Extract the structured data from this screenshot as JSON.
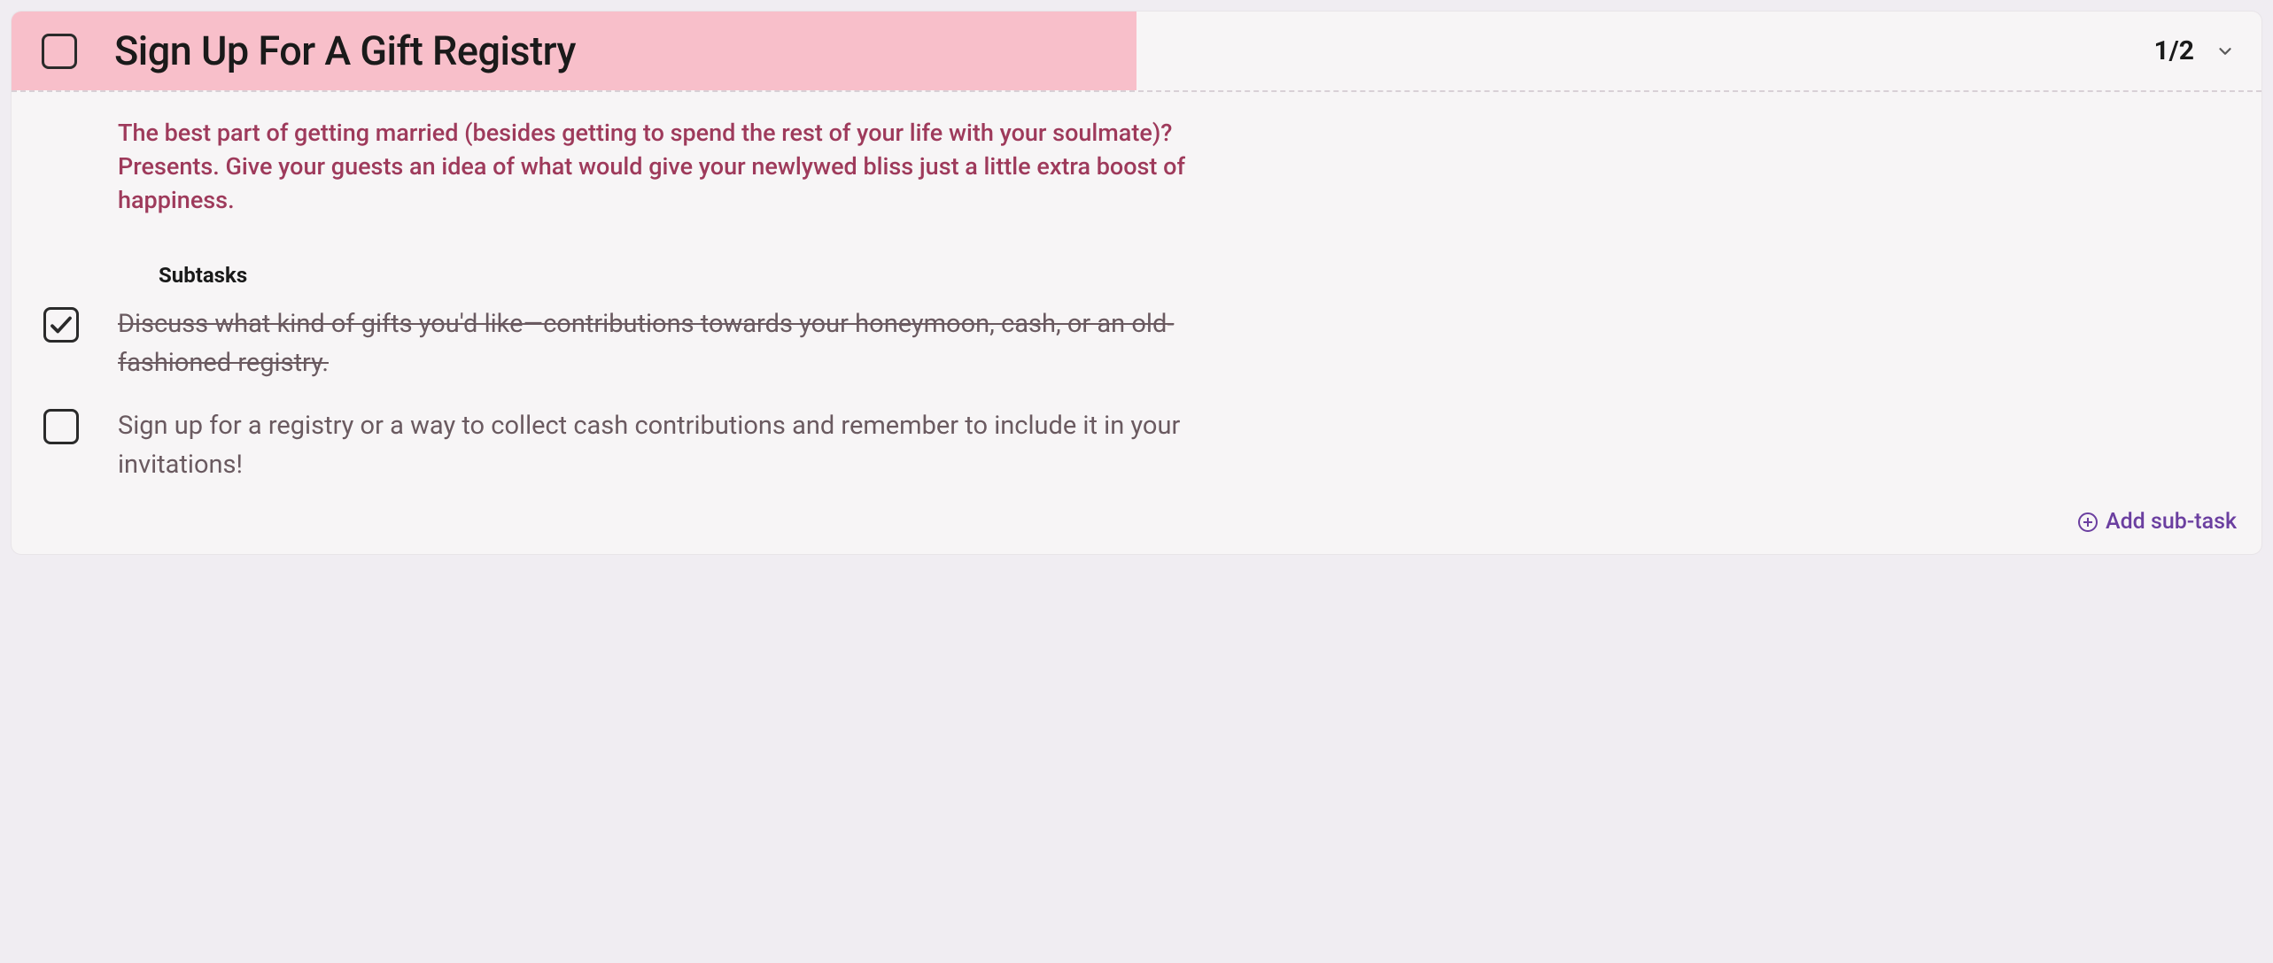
{
  "task": {
    "title": "Sign Up For A Gift Registry",
    "progress": "1/2",
    "completed": false,
    "description": "The best part of getting married (besides getting to spend the rest of your life with your soulmate)? Presents. Give your guests an idea of what would give your newlywed bliss just a little extra boost of happiness."
  },
  "subtasks": {
    "label": "Subtasks",
    "items": [
      {
        "text": "Discuss what kind of gifts you'd like—contributions towards your honeymoon, cash, or an old-fashioned registry.",
        "completed": true
      },
      {
        "text": "Sign up for a registry or a way to collect cash contributions and remember to include it in your invitations!",
        "completed": false
      }
    ]
  },
  "actions": {
    "add_subtask_label": "Add sub-task"
  }
}
